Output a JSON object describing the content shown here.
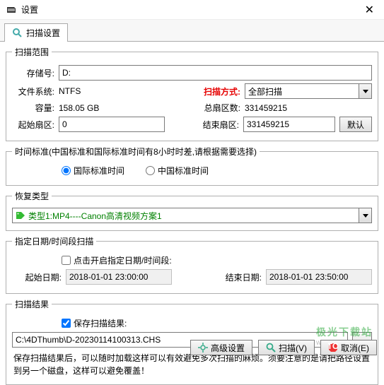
{
  "window": {
    "title": "设置",
    "close": "✕"
  },
  "tab": {
    "label": "扫描设置"
  },
  "scanRange": {
    "legend": "扫描范围",
    "storageLabel": "存储号:",
    "storageValue": "D:",
    "fsLabel": "文件系统:",
    "fsValue": "NTFS",
    "scanMethodLabel": "扫描方式:",
    "scanMethodValue": "全部扫描",
    "capacityLabel": "容量:",
    "capacityValue": "158.05 GB",
    "totalSectorsLabel": "总扇区数:",
    "totalSectorsValue": "331459215",
    "startSectorLabel": "起始扇区:",
    "startSectorValue": "0",
    "endSectorLabel": "结束扇区:",
    "endSectorValue": "331459215",
    "defaultBtn": "默认"
  },
  "timeStd": {
    "legend": "时间标准(中国标准和国际标准时间有8小时时差,请根据需要选择)",
    "intl": "国际标准时间",
    "china": "中国标准时间"
  },
  "recoverType": {
    "legend": "恢复类型",
    "typeText": "类型1:MP4----Canon高清视频方案1"
  },
  "dateRange": {
    "legend": "指定日期/时间段扫描",
    "enable": "点击开启指定日期/时间段:",
    "startLabel": "起始日期:",
    "startValue": "2018-01-01 23:00:00",
    "endLabel": "结束日期:",
    "endValue": "2018-01-01 23:50:00"
  },
  "scanResult": {
    "legend": "扫描结果",
    "save": "保存扫描结果:",
    "path": "C:\\4DThumb\\D-20230114100313.CHS",
    "browse": "...",
    "note": "保存扫描结果后，可以随时加载这样可以有效避免多次扫描的麻烦。须要注意的是请把路径设置到另一个磁盘，这样可以避免覆盖！"
  },
  "buttons": {
    "advanced": "高级设置",
    "scan": "扫描(V)",
    "cancel": "取消(E)"
  },
  "watermark": {
    "top": "极光下载站",
    "bot": "www.xz7.com"
  }
}
